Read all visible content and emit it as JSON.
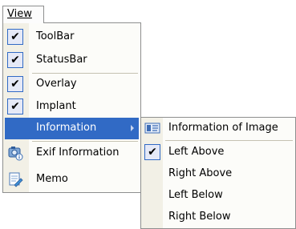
{
  "menubar": {
    "view_label": "View"
  },
  "view_menu": {
    "items": [
      {
        "label": "ToolBar",
        "checked": true
      },
      {
        "label": "StatusBar",
        "checked": true
      },
      {
        "label": "Overlay",
        "checked": true
      },
      {
        "label": "Implant",
        "checked": true
      },
      {
        "label": "Information",
        "has_submenu": true,
        "highlighted": true
      },
      {
        "label": "Exif Information",
        "icon": "exif-info-icon"
      },
      {
        "label": "Memo",
        "icon": "memo-icon"
      }
    ]
  },
  "information_submenu": {
    "items": [
      {
        "label": "Information of Image",
        "icon": "image-info-icon"
      },
      {
        "label": "Left Above",
        "checked": true
      },
      {
        "label": "Right Above"
      },
      {
        "label": "Left Below"
      },
      {
        "label": "Right Below"
      }
    ]
  },
  "colors": {
    "highlight": "#316ac5",
    "gutter": "#f2f0e6",
    "menu_background": "#fcfcf9",
    "border": "#8e8f8f"
  }
}
